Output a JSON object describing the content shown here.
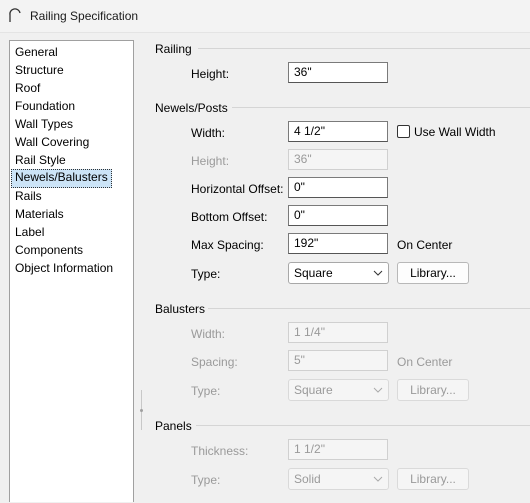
{
  "window": {
    "title": "Railing Specification"
  },
  "nav": {
    "items": [
      "General",
      "Structure",
      "Roof",
      "Foundation",
      "Wall Types",
      "Wall Covering",
      "Rail Style",
      "Newels/Balusters",
      "Rails",
      "Materials",
      "Label",
      "Components",
      "Object Information"
    ],
    "selected": "Newels/Balusters"
  },
  "railing": {
    "title": "Railing",
    "height_label": "Height:",
    "height_value": "36\""
  },
  "newels": {
    "title": "Newels/Posts",
    "width_label": "Width:",
    "width_value": "4 1/2\"",
    "use_wall_width_label": "Use Wall Width",
    "height_label": "Height:",
    "height_value": "36\"",
    "horizontal_offset_label": "Horizontal Offset:",
    "horizontal_offset_value": "0\"",
    "bottom_offset_label": "Bottom Offset:",
    "bottom_offset_value": "0\"",
    "max_spacing_label": "Max Spacing:",
    "max_spacing_value": "192\"",
    "on_center": "On Center",
    "type_label": "Type:",
    "type_value": "Square",
    "library_label": "Library..."
  },
  "balusters": {
    "title": "Balusters",
    "width_label": "Width:",
    "width_value": "1 1/4\"",
    "spacing_label": "Spacing:",
    "spacing_value": "5\"",
    "on_center": "On Center",
    "type_label": "Type:",
    "type_value": "Square",
    "library_label": "Library..."
  },
  "panels": {
    "title": "Panels",
    "thickness_label": "Thickness:",
    "thickness_value": "1 1/2\"",
    "type_label": "Type:",
    "type_value": "Solid",
    "library_label": "Library..."
  }
}
